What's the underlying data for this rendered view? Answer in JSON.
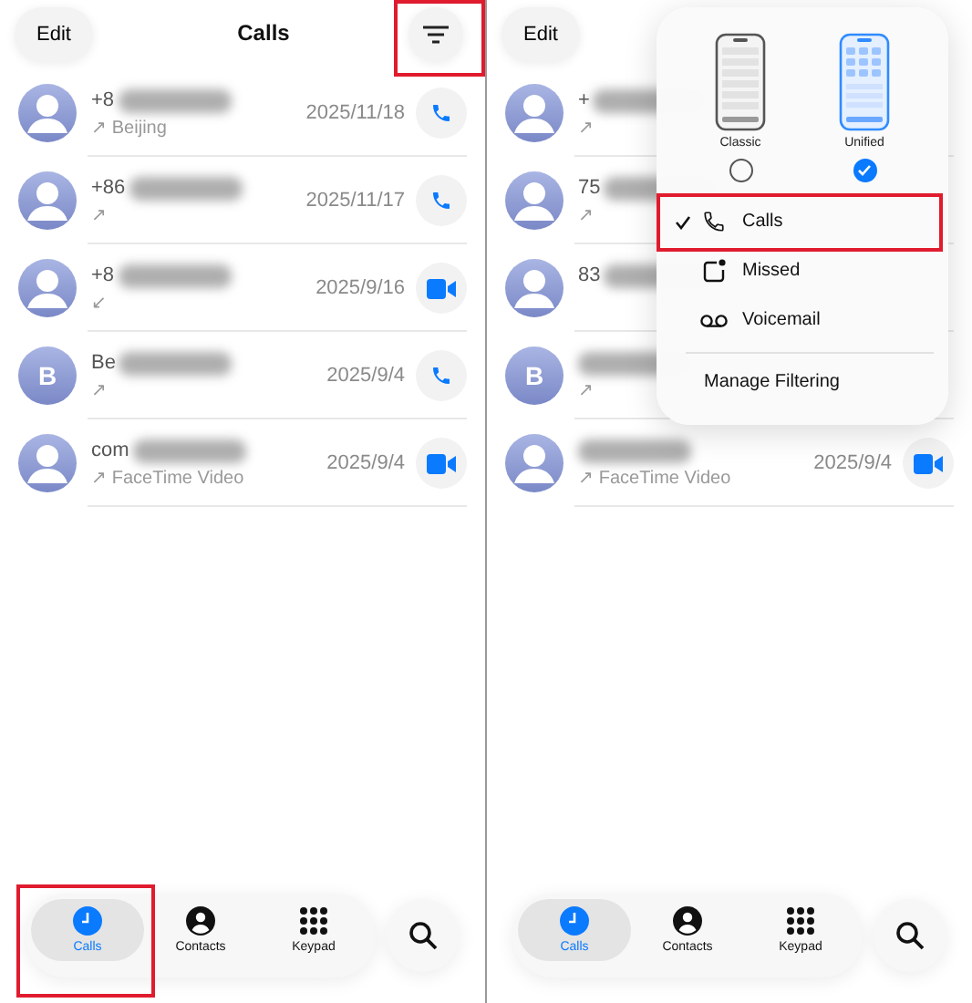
{
  "screens": [
    {
      "header": {
        "edit": "Edit",
        "title": "Calls",
        "filter_highlight": true
      },
      "calls": [
        {
          "name": "+8",
          "arrow": "↗",
          "subtitle": "Beijing",
          "date": "2025/11/18",
          "kind": "phone"
        },
        {
          "name": "+86",
          "arrow": "↗",
          "date": "2025/11/17",
          "kind": "phone"
        },
        {
          "name": "+8",
          "arrow": "↙",
          "date": "2025/9/16",
          "kind": "video"
        },
        {
          "initial": "B",
          "name": "Be",
          "arrow": "↗",
          "date": "2025/9/4",
          "kind": "phone"
        },
        {
          "name": "com",
          "arrow": "↗",
          "subtitle": "FaceTime Video",
          "date": "2025/9/4",
          "kind": "video"
        }
      ],
      "tabs": [
        {
          "label": "Calls",
          "kind": "recents",
          "selected": true,
          "highlight": true
        },
        {
          "label": "Contacts",
          "kind": "contacts",
          "selected": false,
          "highlight": false
        },
        {
          "label": "Keypad",
          "kind": "keypad",
          "selected": false,
          "highlight": false
        }
      ]
    },
    {
      "header": {
        "edit": "Edit"
      },
      "calls": [
        {
          "name": "+",
          "arrow": "↗"
        },
        {
          "name": "75",
          "arrow": "↗"
        },
        {
          "name": "83"
        },
        {
          "initial": "B",
          "arrow": "↗"
        },
        {
          "arrow": "↗",
          "subtitle": "FaceTime Video",
          "date": "2025/9/4",
          "kind": "video"
        }
      ],
      "tabs": [
        {
          "label": "Calls",
          "kind": "recents",
          "selected": true,
          "highlight": false
        },
        {
          "label": "Contacts",
          "kind": "contacts",
          "selected": false,
          "highlight": false
        },
        {
          "label": "Keypad",
          "kind": "keypad",
          "selected": false,
          "highlight": false
        }
      ],
      "menu": {
        "layouts": [
          {
            "label": "Classic",
            "selected": false
          },
          {
            "label": "Unified",
            "selected": true
          }
        ],
        "items": [
          {
            "label": "Calls",
            "kind": "calls",
            "checked": true,
            "highlight": true
          },
          {
            "label": "Missed",
            "kind": "missed",
            "checked": false,
            "highlight": false
          },
          {
            "label": "Voicemail",
            "kind": "voicemail",
            "checked": false,
            "highlight": false
          }
        ],
        "footer": "Manage Filtering"
      }
    }
  ]
}
